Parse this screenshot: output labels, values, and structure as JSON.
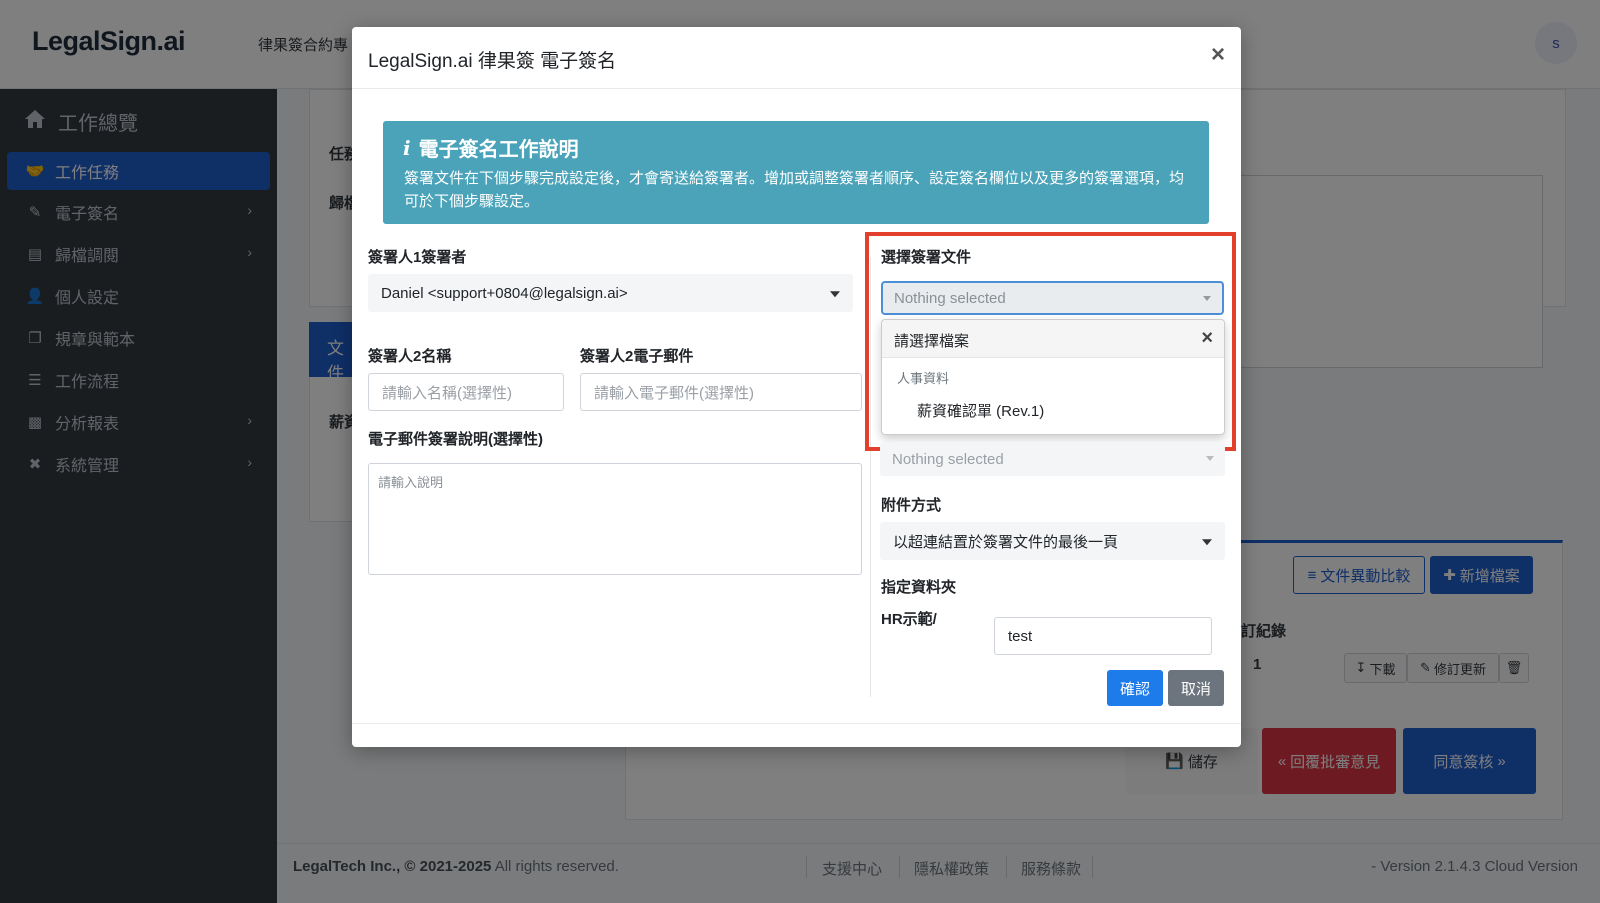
{
  "header": {
    "logo": "LegalSign.ai",
    "nav_text": "律果簽合約專",
    "avatar_initial": "s"
  },
  "sidebar": {
    "home_label": "工作總覽",
    "items": [
      {
        "label": "工作任務",
        "icon": "handshake-icon",
        "active": true
      },
      {
        "label": "電子簽名",
        "icon": "signature-icon",
        "has_submenu": true
      },
      {
        "label": "歸檔調閱",
        "icon": "archive-icon",
        "has_submenu": true
      },
      {
        "label": "個人設定",
        "icon": "user-gear-icon"
      },
      {
        "label": "規章與範本",
        "icon": "copy-icon"
      },
      {
        "label": "工作流程",
        "icon": "list-icon"
      },
      {
        "label": "分析報表",
        "icon": "chart-icon",
        "has_submenu": true
      },
      {
        "label": "系統管理",
        "icon": "tools-icon",
        "has_submenu": true
      }
    ]
  },
  "background": {
    "label_task": "任務",
    "label_archive": "歸檔",
    "tab_doc": "文件",
    "label_salary": "薪資",
    "compare_button": "文件異動比較",
    "new_file_button": "新增檔案",
    "revision_record_header": "訂紀錄",
    "revision_value": "1",
    "download_button": "下載",
    "revise_button": "修訂更新",
    "save_button": "儲存",
    "reply_button": "回覆批審意見",
    "approve_button": "同意簽核"
  },
  "footer": {
    "company": "LegalTech Inc.,",
    "copyright_years": "© 2021-2025",
    "rights": "All rights reserved.",
    "links": [
      "支援中心",
      "隱私權政策",
      "服務條款"
    ],
    "version": "- Version 2.1.4.3 Cloud Version"
  },
  "modal": {
    "title": "LegalSign.ai 律果簽 電子簽名",
    "info_title": "電子簽名工作說明",
    "info_text": "簽署文件在下個步驟完成設定後，才會寄送給簽署者。增加或調整簽署者順序、設定簽名欄位以及更多的簽署選項，均可於下個步驟設定。",
    "signer1_label": "簽署人1簽署者",
    "signer1_value": "Daniel <support+0804@legalsign.ai>",
    "signer2_name_label": "簽署人2名稱",
    "signer2_name_placeholder": "請輸入名稱(選擇性)",
    "signer2_email_label": "簽署人2電子郵件",
    "signer2_email_placeholder": "請輸入電子郵件(選擇性)",
    "email_note_label": "電子郵件簽署說明(選擇性)",
    "email_note_placeholder": "請輸入說明",
    "doc_select_label": "選擇簽署文件",
    "doc_select_value": "Nothing selected",
    "dropdown_header": "請選擇檔案",
    "dropdown_group": "人事資料",
    "dropdown_option": "薪資確認單 (Rev.1)",
    "attachment_select_value": "Nothing selected",
    "attach_method_label": "附件方式",
    "attach_method_value": "以超連結置於簽署文件的最後一頁",
    "folder_label": "指定資料夾",
    "folder_path": "HR示範/",
    "folder_value": "test",
    "confirm_button": "確認",
    "cancel_button": "取消"
  },
  "colors": {
    "sidebar_bg": "#343a40",
    "active_blue": "#1f5fcf",
    "info_teal": "#4aa3b9",
    "highlight_red": "#e2402c",
    "danger": "#dc3545"
  }
}
